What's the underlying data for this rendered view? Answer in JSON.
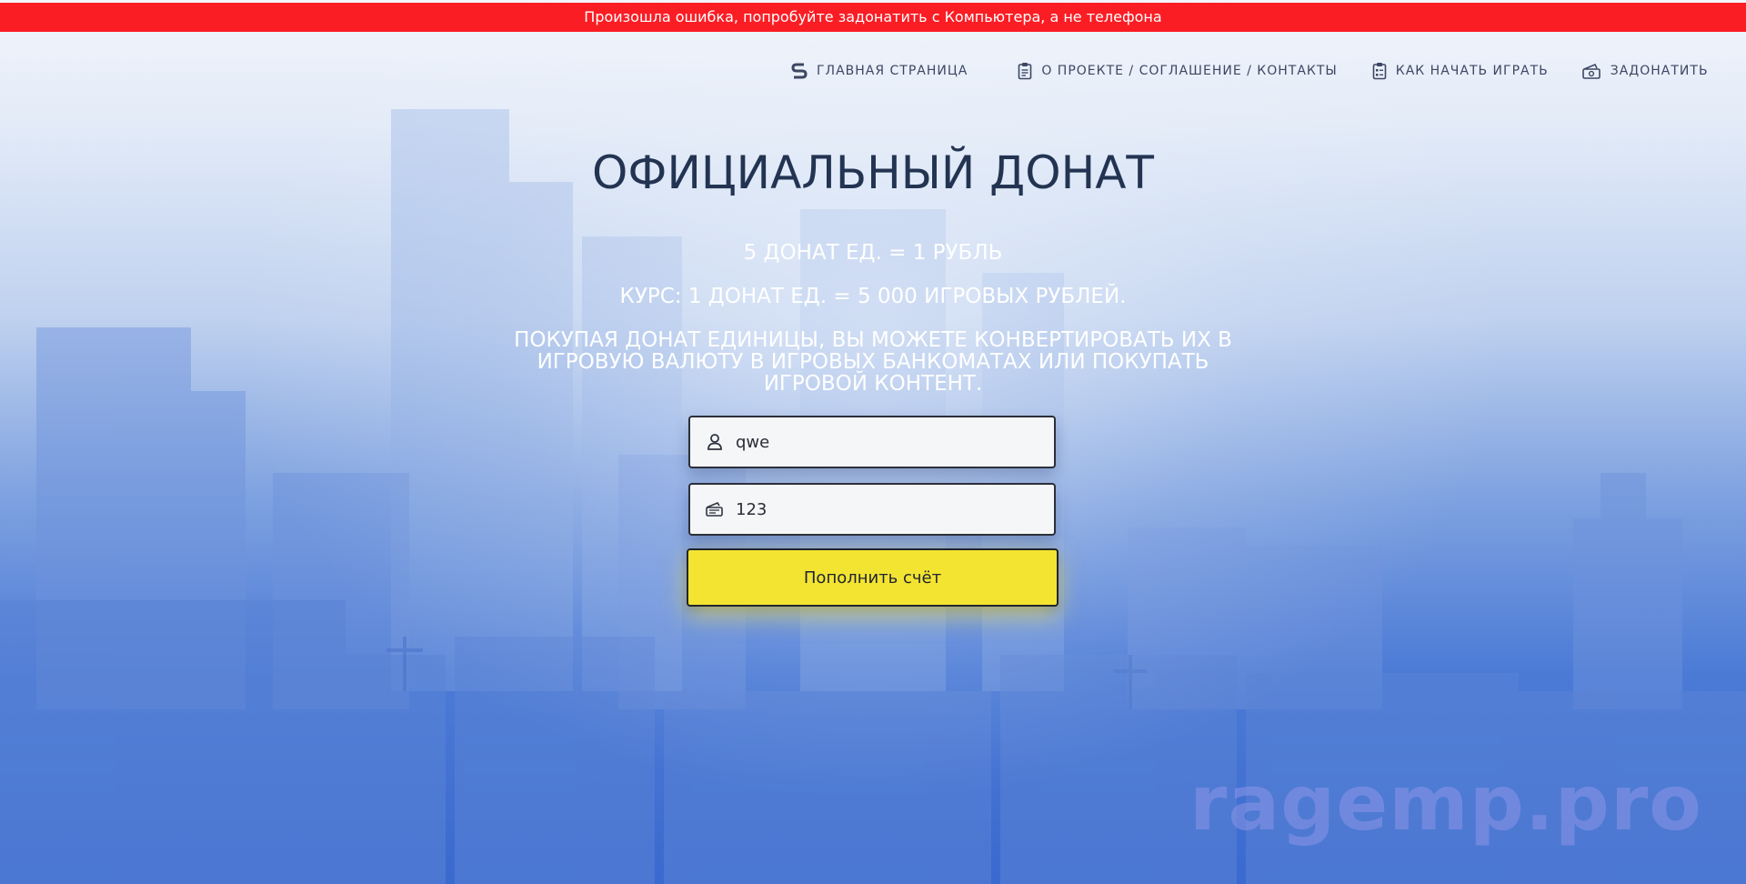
{
  "error_bar": {
    "text": "Произошла ошибка, попробуйте задонатить с Компьютера, а не телефона",
    "color": "#fb1d24"
  },
  "nav": {
    "items": [
      {
        "label": "ГЛАВНАЯ СТРАНИЦА",
        "icon": "logo-s-icon"
      },
      {
        "label": "О ПРОЕКТЕ / СОГЛАШЕНИЕ / КОНТАКТЫ",
        "icon": "clipboard-icon"
      },
      {
        "label": "КАК НАЧАТЬ ИГРАТЬ",
        "icon": "checklist-icon"
      },
      {
        "label": "ЗАДОНАТИТЬ",
        "icon": "money-icon"
      }
    ]
  },
  "hero": {
    "title": "ОФИЦИАЛЬНЫЙ ДОНАТ",
    "rate": "5 ДОНАТ ЕД. = 1 РУБЛЬ",
    "course": "КУРС: 1 ДОНАТ ЕД. = 5 000 ИГРОВЫХ РУБЛЕЙ.",
    "description": "ПОКУПАЯ ДОНАТ ЕДИНИЦЫ, ВЫ МОЖЕТЕ КОНВЕРТИРОВАТЬ ИХ В ИГРОВУЮ ВАЛЮТУ В ИГРОВЫХ БАНКОМАТАХ ИЛИ ПОКУПАТЬ ИГРОВОЙ КОНТЕНТ."
  },
  "form": {
    "login_value": "qwe",
    "login_icon": "user-icon",
    "amount_value": "123",
    "amount_icon": "cash-icon",
    "submit_label": "Пополнить счёт",
    "submit_color": "#f3e431"
  },
  "watermark": "ragemp.pro"
}
